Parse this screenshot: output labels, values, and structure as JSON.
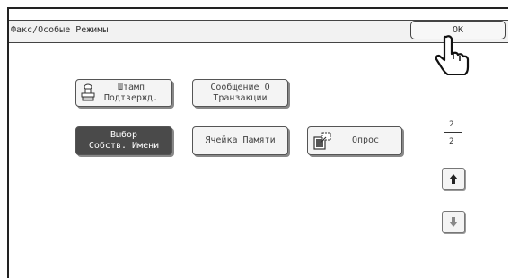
{
  "header": {
    "title": "Факс/Особые Режимы",
    "ok_label": "OK"
  },
  "buttons": {
    "stamp": {
      "line1": "Штамп",
      "line2": "Подтвержд."
    },
    "message": {
      "line1": "Сообщение О",
      "line2": "Транзакции"
    },
    "own_name": {
      "line1": "Выбор",
      "line2": "Собств. Имени"
    },
    "memory_box": {
      "label": "Ячейка Памяти"
    },
    "polling": {
      "label": "Опрос"
    }
  },
  "pagination": {
    "current_page": "2",
    "total_pages": "2"
  },
  "icons": {
    "stamp": "stamp-icon",
    "polling": "polling-icon",
    "pointer": "hand-pointer-icon",
    "up": "arrow-up-icon",
    "down": "arrow-down-icon"
  },
  "colors": {
    "selected_button": "#4a4a4a",
    "button_bg": "#f4f4f4"
  }
}
